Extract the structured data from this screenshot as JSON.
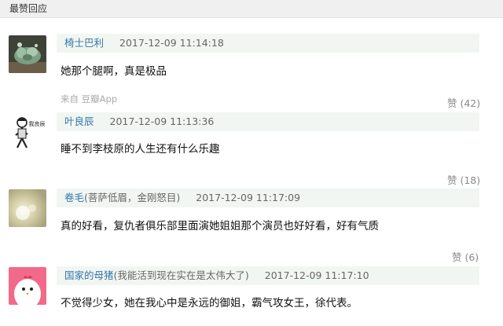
{
  "section_title": "最赞回应",
  "comments": [
    {
      "author": "椅士巴利",
      "signature": "",
      "time": "2017-12-09 11:14:18",
      "text": "她那个腿啊，真是极品",
      "from": "来自 豆瓣App",
      "votes": "赞 (42)",
      "avatar_icon": "succulent-plant-avatar"
    },
    {
      "author": "叶良辰",
      "signature": "",
      "time": "2017-12-09 11:13:36",
      "text": "睡不到李枝原的人生还有什么乐趣",
      "from": "",
      "votes": "赞 (18)",
      "avatar_icon": "cartoon-man-avatar",
      "avatar_text": "我良辰"
    },
    {
      "author": "卷毛",
      "signature": "(菩萨低眉，金刚怒目)",
      "time": "2017-12-09 11:17:09",
      "text": "真的好看，复仇者俱乐部里面演她姐姐那个演员也好好看，好有气质",
      "from": "",
      "votes": "赞 (6)",
      "avatar_icon": "blurry-flower-avatar"
    },
    {
      "author": "国家的母猪",
      "signature": "(我能活到现在实在是太伟大了)",
      "time": "2017-12-09 11:17:10",
      "text": "不觉得少女，她在我心中是永远的御姐，霸气攻女王，徐代表。",
      "from": "",
      "votes": "",
      "avatar_icon": "cartoon-chicken-avatar"
    }
  ]
}
